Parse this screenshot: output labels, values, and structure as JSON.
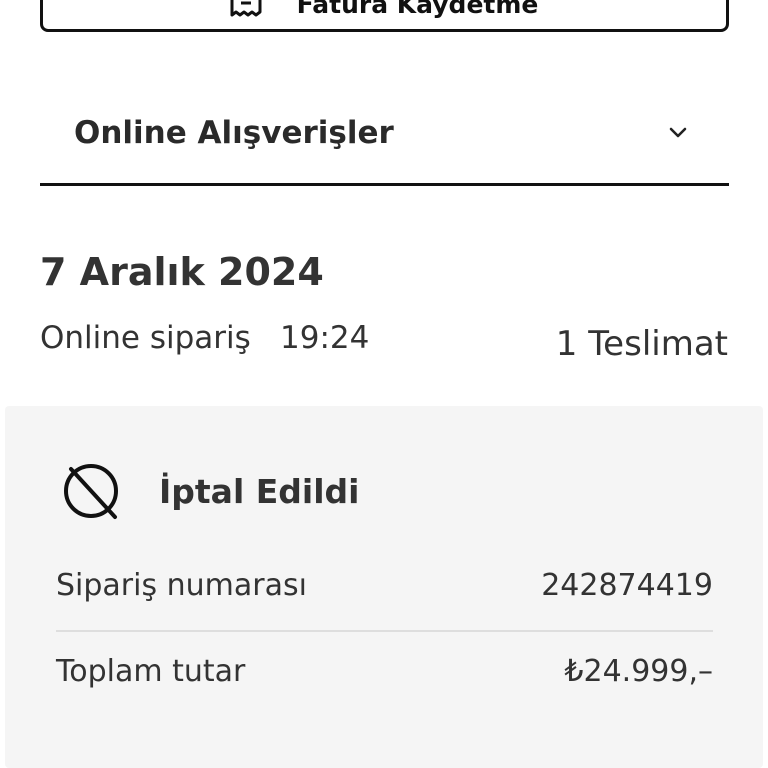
{
  "invoice_button": {
    "label": "Fatura Kaydetme",
    "icon": "receipt-icon"
  },
  "accordion": {
    "title": "Online Alışverişler",
    "icon": "chevron-down-icon"
  },
  "order": {
    "date": "7 Aralık 2024",
    "channel": "Online sipariş",
    "time": "19:24",
    "deliveries": "1 Teslimat"
  },
  "card": {
    "status": "İptal Edildi",
    "status_icon": "cancelled-icon",
    "rows": [
      {
        "label": "Sipariş numarası",
        "value": "242874419"
      },
      {
        "label": "Toplam tutar",
        "value": "₺24.999,–"
      }
    ]
  },
  "colors": {
    "text": "#333333",
    "border": "#111111",
    "card_bg": "#f5f5f5",
    "divider": "#dedede"
  }
}
